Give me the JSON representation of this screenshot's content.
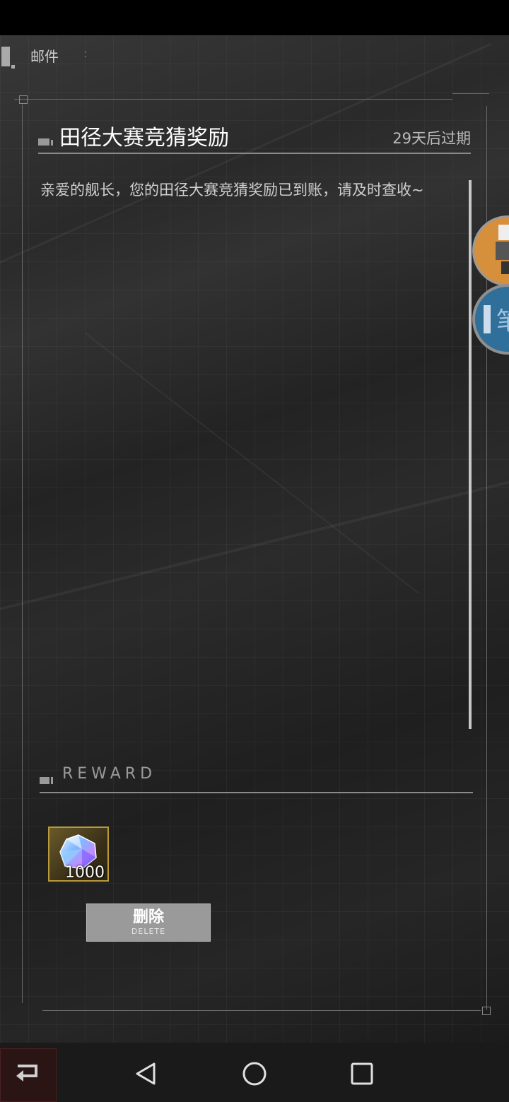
{
  "app": {
    "title": "邮件"
  },
  "mail": {
    "title": "田径大赛竞猜奖励",
    "expiry": "29天后过期",
    "body": "亲爱的舰长，您的田径大赛竞猜奖励已到账，请及时查收~"
  },
  "reward": {
    "label": "REWARD",
    "items": [
      {
        "icon": "crystal-gem-icon",
        "count": "1000"
      }
    ]
  },
  "actions": {
    "delete_label": "删除",
    "delete_sub": "DELETE"
  },
  "floating": {
    "blue_text": "笔"
  },
  "colors": {
    "accent_gold": "#b99a3a",
    "panel_bg": "#2a2a2a"
  },
  "system_nav": {
    "back": "back-triangle-icon",
    "home": "home-circle-icon",
    "recents": "recents-square-icon"
  }
}
